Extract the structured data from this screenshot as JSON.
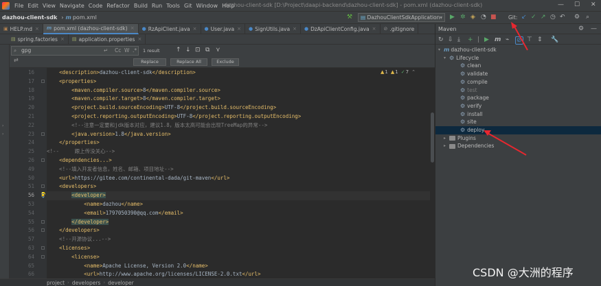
{
  "menu": {
    "items": [
      "File",
      "Edit",
      "View",
      "Navigate",
      "Code",
      "Refactor",
      "Build",
      "Run",
      "Tools",
      "Git",
      "Window",
      "Help"
    ],
    "window_title": "dazhou-client-sdk [D:\\Project\\daapi-backend\\dazhou-client-sdk] - pom.xml (dazhou-client-sdk)"
  },
  "nav": {
    "project": "dazhou-client-sdk",
    "file": "pom.xml",
    "run_config": "DazhouClientSdkApplication",
    "git_label": "Git:"
  },
  "tabs_row1": [
    {
      "label": "HELP.md",
      "icon": "md-file-icon"
    },
    {
      "label": "pom.xml (dazhou-client-sdk)",
      "icon": "maven-icon",
      "active": true
    },
    {
      "label": "RzApiClient.java",
      "icon": "class-icon"
    },
    {
      "label": "User.java",
      "icon": "class-icon"
    },
    {
      "label": "SignUtils.java",
      "icon": "class-icon"
    },
    {
      "label": "DzApiClientConfig.java",
      "icon": "class-icon"
    },
    {
      "label": ".gitignore",
      "icon": "gitignore-icon"
    }
  ],
  "tabs_row2": [
    {
      "label": "spring.factories",
      "icon": "properties-icon"
    },
    {
      "label": "application.properties",
      "icon": "properties-icon"
    }
  ],
  "find": {
    "query": "gpg",
    "result_count": "1 result",
    "replace_label": "Replace",
    "replace_all_label": "Replace All",
    "exclude_label": "Exclude"
  },
  "editor": {
    "warnings": {
      "warn1": "1",
      "warn2": "1",
      "info": "7"
    },
    "current_line": 56,
    "lines": [
      {
        "n": 16,
        "text": "    <description>dazhou-client-sdk</description>"
      },
      {
        "n": 17,
        "text": "    <properties>"
      },
      {
        "n": 18,
        "text": "        <maven.compiler.source>8</maven.compiler.source>"
      },
      {
        "n": 19,
        "text": "        <maven.compiler.target>8</maven.compiler.target>"
      },
      {
        "n": 20,
        "text": "        <project.build.sourceEncoding>UTF-8</project.build.sourceEncoding>"
      },
      {
        "n": 21,
        "text": "        <project.reporting.outputEncoding>UTF-8</project.reporting.outputEncoding>"
      },
      {
        "n": 22,
        "text": "        <!--注意一定要和jdk版本对应，建议1.8，版本太高可能会出现TreeMap的异常-->"
      },
      {
        "n": 23,
        "text": "        <java.version>1.8</java.version>"
      },
      {
        "n": 24,
        "text": "    </properties>"
      },
      {
        "n": 25,
        "text": "<!--     跟上传没关心-->"
      },
      {
        "n": 26,
        "text": "    <dependencies...>"
      },
      {
        "n": 49,
        "text": "    <!--填入开发者信息，姓名、邮箱、项目地址-->"
      },
      {
        "n": 50,
        "text": "    <url>https://gitee.com/continental-dada/git-maven</url>"
      },
      {
        "n": 51,
        "text": "    <developers>"
      },
      {
        "n": 56,
        "text": "        <developer>"
      },
      {
        "n": 53,
        "text": "            <name>dazhou</name>"
      },
      {
        "n": 54,
        "text": "            <email>1797050390@qq.com</email>"
      },
      {
        "n": 55,
        "text": "        </developer>"
      },
      {
        "n": 56,
        "text": "    </developers>"
      },
      {
        "n": 57,
        "text": "    <!--开源协议...-->"
      },
      {
        "n": 63,
        "text": "    <licenses>"
      },
      {
        "n": 64,
        "text": "        <license>"
      },
      {
        "n": 65,
        "text": "            <name>Apache License, Version 2.0</name>"
      },
      {
        "n": 66,
        "text": "            <url>http://www.apache.org/licenses/LICENSE-2.0.txt</url>"
      }
    ]
  },
  "breadcrumb": [
    "project",
    "developers",
    "developer"
  ],
  "maven": {
    "title": "Maven",
    "project": "dazhou-client-sdk",
    "lifecycle_label": "Lifecycle",
    "goals": [
      "clean",
      "validate",
      "compile",
      "test",
      "package",
      "verify",
      "install",
      "site",
      "deploy"
    ],
    "selected_goal": "deploy",
    "plugins_label": "Plugins",
    "dependencies_label": "Dependencies"
  },
  "watermark": "CSDN @大洲的程序"
}
